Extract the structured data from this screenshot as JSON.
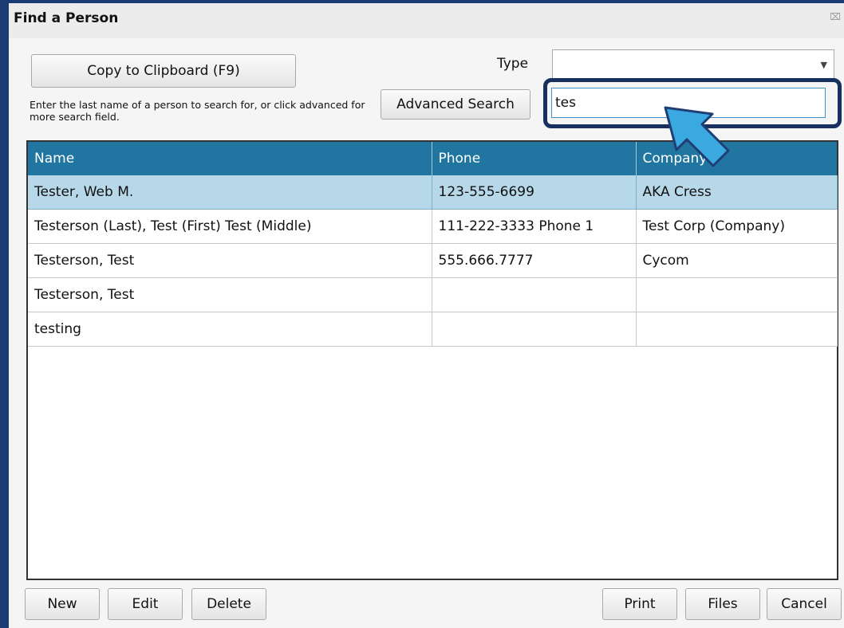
{
  "window": {
    "title": "Find a Person",
    "close_glyph": "⌧"
  },
  "toolbar": {
    "copy_label": "Copy to Clipboard (F9)",
    "advanced_label": "Advanced Search",
    "hint": "Enter the last name of a person to search for, or click advanced for more search field."
  },
  "type_filter": {
    "label": "Type",
    "value": ""
  },
  "search": {
    "value": "tes"
  },
  "table": {
    "columns": [
      "Name",
      "Phone",
      "Company"
    ],
    "rows": [
      [
        "Tester, Web M.",
        "123-555-6699",
        "AKA Cress"
      ],
      [
        "Testerson (Last), Test (First) Test (Middle)",
        "111-222-3333 Phone 1",
        "Test Corp (Company)"
      ],
      [
        "Testerson, Test",
        "555.666.7777",
        "Cycom"
      ],
      [
        "Testerson, Test",
        "",
        ""
      ],
      [
        "testing",
        "",
        ""
      ]
    ],
    "selected_row": 0
  },
  "footer": {
    "new_label": "New",
    "edit_label": "Edit",
    "delete_label": "Delete",
    "print_label": "Print",
    "files_label": "Files",
    "cancel_label": "Cancel"
  },
  "colors": {
    "header_bg": "#2076a0",
    "selected_row_bg": "#b7d8e8",
    "frame": "#1c3a74",
    "callout_arrow": "#3aa9e0"
  },
  "icons": {
    "callout": "arrow-pointer-icon",
    "dropdown": "chevron-down-icon"
  }
}
